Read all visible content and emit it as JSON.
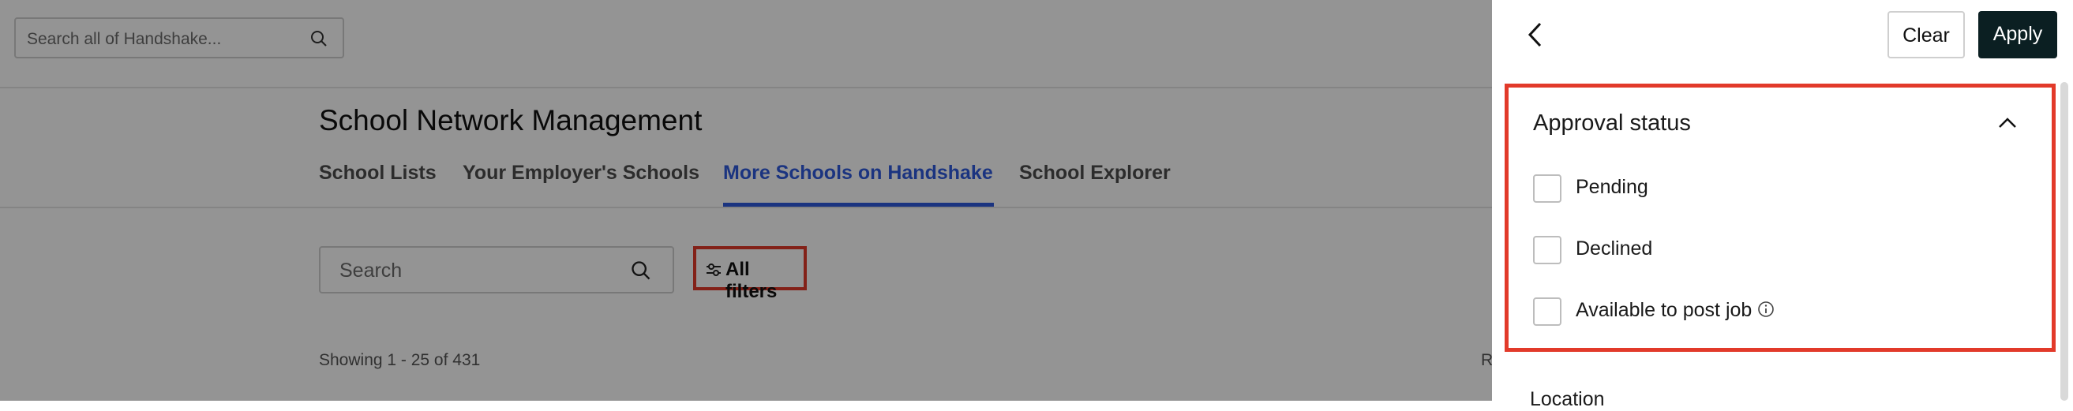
{
  "header": {
    "search_placeholder": "Search all of Handshake..."
  },
  "page": {
    "title": "School Network Management",
    "tabs": [
      {
        "label": "School Lists"
      },
      {
        "label": "Your Employer's Schools"
      },
      {
        "label": "More Schools on Handshake"
      },
      {
        "label": "School Explorer"
      }
    ],
    "active_tab": "More Schools on Handshake",
    "search_placeholder": "Search",
    "all_filters_label": "All filters",
    "showing_text": "Showing 1 - 25 of 431",
    "partial_right_text": "R"
  },
  "panel": {
    "clear_label": "Clear",
    "apply_label": "Apply",
    "section_title": "Approval status",
    "options": [
      {
        "label": "Pending",
        "checked": false
      },
      {
        "label": "Declined",
        "checked": false
      },
      {
        "label": "Available to post job",
        "checked": false
      }
    ],
    "next_section_partial": "Location"
  },
  "colors": {
    "accent": "#2f5bdc",
    "highlight": "#e23a2a",
    "apply_bg": "#0b1f22"
  }
}
